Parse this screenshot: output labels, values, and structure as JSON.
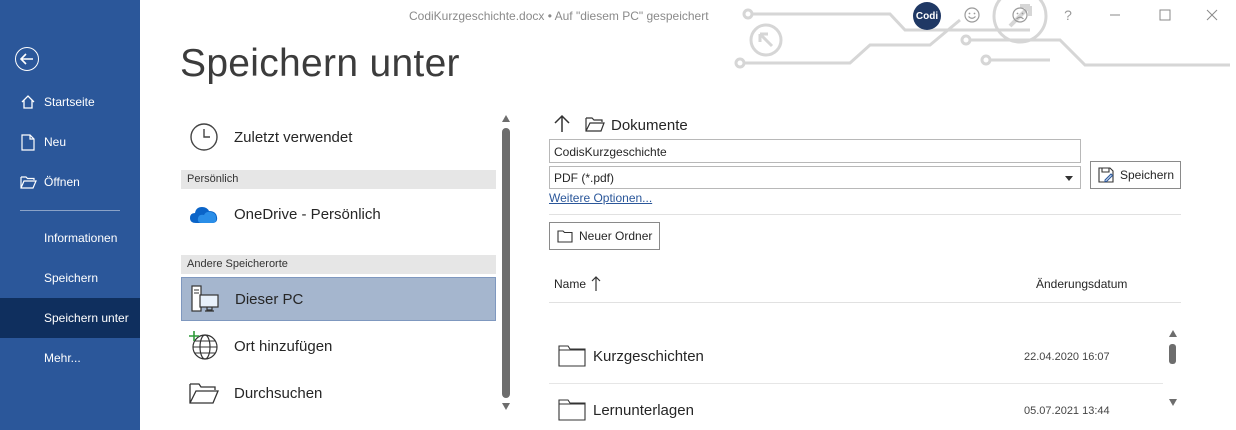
{
  "window": {
    "title": "CodiKurzgeschichte.docx • Auf \"diesem PC\" gespeichert",
    "badge": "Codi",
    "help": "?"
  },
  "sidebar": {
    "items": [
      {
        "label": "Startseite",
        "icon": "home-icon"
      },
      {
        "label": "Neu",
        "icon": "new-document-icon"
      },
      {
        "label": "Öffnen",
        "icon": "open-folder-icon"
      },
      {
        "label": "Informationen"
      },
      {
        "label": "Speichern"
      },
      {
        "label": "Speichern unter",
        "active": true
      },
      {
        "label": "Mehr..."
      }
    ]
  },
  "page": {
    "title": "Speichern unter"
  },
  "locations": {
    "recent": "Zuletzt verwendet",
    "personal_header": "Persönlich",
    "onedrive": "OneDrive - Persönlich",
    "other_header": "Andere Speicherorte",
    "this_pc": "Dieser PC",
    "add_place": "Ort hinzufügen",
    "browse": "Durchsuchen"
  },
  "save_pane": {
    "breadcrumb": "Dokumente",
    "filename_value": "CodisKurzgeschichte",
    "filetype_value": "PDF (*.pdf)",
    "more_options": "Weitere Optionen...",
    "save_label": "Speichern",
    "new_folder_label": "Neuer Ordner",
    "col_name": "Name",
    "col_date": "Änderungsdatum",
    "files": [
      {
        "name": "Kurzgeschichten",
        "date": "22.04.2020 16:07"
      },
      {
        "name": "Lernunterlagen",
        "date": "05.07.2021 13:44"
      }
    ]
  },
  "colors": {
    "sidebar": "#2b579a",
    "sidebar_active": "#0f2f5e",
    "selected_location": "#a5b6ce",
    "link": "#2b579a"
  }
}
